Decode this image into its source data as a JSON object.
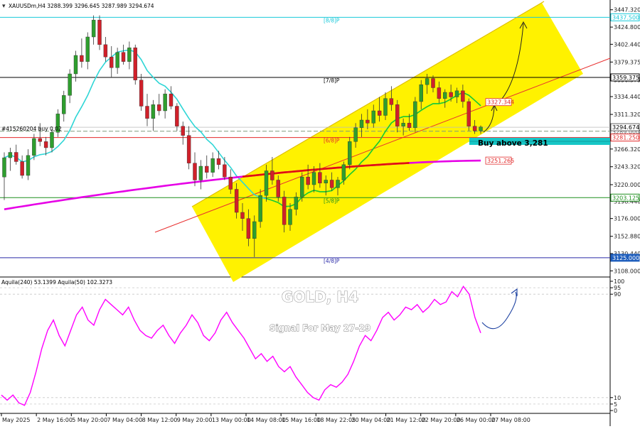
{
  "header": {
    "symbol_line": "XAUUSDm,H4  3288.399 3296.645 3287.989 3294.674",
    "order_label": "#415260204 buy 0.02"
  },
  "annotations": {
    "title": "GOLD, H4",
    "subtitle": "Signal For May 27-29",
    "buy_text": "Buy above 3,281"
  },
  "colors": {
    "channel_fill": "#fff200",
    "candle_up": "#2e9e2e",
    "candle_down": "#d0202a",
    "ma_sma21": "#2fd6d6",
    "ma_sma200": "#e600e6",
    "ma_green": "#22cc22",
    "ma_red": "#e01010",
    "oscillator": "#ff00ff",
    "price_tag": "#1f5ebd"
  },
  "chart_data": [
    {
      "type": "candlestick",
      "symbol": "XAUUSDm",
      "timeframe": "H4",
      "header_values": {
        "open": 3288.399,
        "high": 3296.645,
        "low": 3287.989,
        "close": 3294.674
      },
      "ylim": [
        3100,
        3460
      ],
      "y_ticks": [
        3447.32,
        3424.8,
        3402.44,
        3379.375,
        3356.375,
        3334.44,
        3311.32,
        3289.0,
        3266.32,
        3243.32,
        3220.0,
        3198.44,
        3176.0,
        3152.88,
        3130.44,
        3108.0
      ],
      "x_ticks": [
        "May 2025",
        "2 May 16:00",
        "5 May 20:00",
        "7 May 04:00",
        "8 May 12:00",
        "9 May 20:00",
        "13 May 00:00",
        "14 May 08:00",
        "15 May 16:00",
        "18 May 22:05",
        "20 May 04:00",
        "21 May 12:00",
        "22 May 20:00",
        "26 May 00:00",
        "27 May 08:00"
      ],
      "ohlc": [
        [
          3230,
          3262,
          3200,
          3255
        ],
        [
          3255,
          3268,
          3238,
          3262
        ],
        [
          3262,
          3272,
          3246,
          3250
        ],
        [
          3250,
          3258,
          3228,
          3232
        ],
        [
          3232,
          3266,
          3226,
          3258
        ],
        [
          3258,
          3286,
          3252,
          3280
        ],
        [
          3280,
          3300,
          3270,
          3276
        ],
        [
          3276,
          3282,
          3258,
          3268
        ],
        [
          3268,
          3292,
          3262,
          3288
        ],
        [
          3288,
          3318,
          3282,
          3312
        ],
        [
          3312,
          3342,
          3302,
          3336
        ],
        [
          3336,
          3370,
          3326,
          3364
        ],
        [
          3364,
          3394,
          3354,
          3388
        ],
        [
          3388,
          3410,
          3372,
          3380
        ],
        [
          3380,
          3418,
          3370,
          3412
        ],
        [
          3412,
          3440,
          3402,
          3434
        ],
        [
          3434,
          3440,
          3395,
          3402
        ],
        [
          3402,
          3412,
          3380,
          3386
        ],
        [
          3386,
          3400,
          3360,
          3372
        ],
        [
          3372,
          3398,
          3364,
          3392
        ],
        [
          3392,
          3402,
          3376,
          3380
        ],
        [
          3380,
          3406,
          3370,
          3398
        ],
        [
          3398,
          3402,
          3350,
          3356
        ],
        [
          3356,
          3364,
          3316,
          3322
        ],
        [
          3322,
          3338,
          3296,
          3306
        ],
        [
          3306,
          3330,
          3290,
          3324
        ],
        [
          3324,
          3338,
          3310,
          3316
        ],
        [
          3316,
          3344,
          3306,
          3338
        ],
        [
          3338,
          3348,
          3318,
          3322
        ],
        [
          3322,
          3326,
          3290,
          3296
        ],
        [
          3296,
          3302,
          3272,
          3284
        ],
        [
          3284,
          3296,
          3240,
          3248
        ],
        [
          3248,
          3262,
          3218,
          3226
        ],
        [
          3226,
          3252,
          3214,
          3244
        ],
        [
          3244,
          3258,
          3228,
          3236
        ],
        [
          3236,
          3262,
          3230,
          3254
        ],
        [
          3254,
          3264,
          3240,
          3246
        ],
        [
          3246,
          3256,
          3226,
          3230
        ],
        [
          3230,
          3240,
          3208,
          3214
        ],
        [
          3214,
          3222,
          3176,
          3184
        ],
        [
          3184,
          3196,
          3160,
          3176
        ],
        [
          3176,
          3188,
          3140,
          3150
        ],
        [
          3150,
          3180,
          3126,
          3172
        ],
        [
          3172,
          3214,
          3164,
          3206
        ],
        [
          3206,
          3246,
          3198,
          3238
        ],
        [
          3238,
          3256,
          3220,
          3226
        ],
        [
          3226,
          3232,
          3198,
          3204
        ],
        [
          3204,
          3212,
          3158,
          3168
        ],
        [
          3168,
          3196,
          3160,
          3188
        ],
        [
          3188,
          3210,
          3180,
          3204
        ],
        [
          3204,
          3236,
          3198,
          3230
        ],
        [
          3230,
          3246,
          3214,
          3220
        ],
        [
          3220,
          3244,
          3210,
          3236
        ],
        [
          3236,
          3248,
          3216,
          3222
        ],
        [
          3222,
          3232,
          3206,
          3226
        ],
        [
          3226,
          3236,
          3212,
          3216
        ],
        [
          3216,
          3230,
          3206,
          3226
        ],
        [
          3226,
          3250,
          3220,
          3246
        ],
        [
          3246,
          3282,
          3240,
          3276
        ],
        [
          3276,
          3300,
          3268,
          3294
        ],
        [
          3294,
          3312,
          3282,
          3304
        ],
        [
          3304,
          3318,
          3292,
          3300
        ],
        [
          3300,
          3324,
          3294,
          3316
        ],
        [
          3316,
          3334,
          3302,
          3310
        ],
        [
          3310,
          3340,
          3304,
          3332
        ],
        [
          3332,
          3348,
          3316,
          3324
        ],
        [
          3324,
          3330,
          3288,
          3296
        ],
        [
          3296,
          3306,
          3284,
          3300
        ],
        [
          3300,
          3312,
          3290,
          3294
        ],
        [
          3294,
          3334,
          3288,
          3328
        ],
        [
          3328,
          3356,
          3318,
          3350
        ],
        [
          3350,
          3364,
          3338,
          3358
        ],
        [
          3358,
          3362,
          3340,
          3346
        ],
        [
          3346,
          3354,
          3326,
          3332
        ],
        [
          3332,
          3344,
          3320,
          3340
        ],
        [
          3340,
          3350,
          3328,
          3334
        ],
        [
          3334,
          3346,
          3326,
          3342
        ],
        [
          3342,
          3350,
          3320,
          3328
        ],
        [
          3328,
          3332,
          3290,
          3296
        ],
        [
          3296,
          3304,
          3286,
          3290
        ],
        [
          3290,
          3297,
          3286,
          3295
        ]
      ]
    },
    {
      "type": "line",
      "name": "Aquila(240) 53.1399 Aquila(50) 102.3273",
      "ylim": [
        0,
        100
      ],
      "y_ticks": [
        100,
        95,
        90,
        10,
        5,
        0
      ],
      "values": [
        12,
        8,
        12,
        6,
        4,
        14,
        30,
        48,
        62,
        70,
        58,
        50,
        62,
        74,
        80,
        70,
        66,
        78,
        86,
        82,
        78,
        74,
        80,
        70,
        62,
        58,
        56,
        62,
        66,
        58,
        52,
        60,
        66,
        74,
        68,
        58,
        54,
        60,
        70,
        76,
        68,
        62,
        56,
        48,
        40,
        44,
        38,
        42,
        34,
        30,
        34,
        26,
        20,
        14,
        10,
        8,
        16,
        20,
        18,
        22,
        28,
        38,
        50,
        58,
        54,
        62,
        72,
        76,
        70,
        74,
        80,
        78,
        82,
        76,
        80,
        86,
        82,
        84,
        92,
        88,
        96,
        90,
        72,
        60
      ]
    }
  ],
  "levels": [
    {
      "label": "[8/8]P",
      "price_tag": "3437.500"
    },
    {
      "label": "[7/8]P",
      "price_tag": "3359.375"
    },
    {
      "label": "[6/8]P",
      "price_tag": "3281.250"
    },
    {
      "label": "[5/8]P",
      "price_tag": "3203.125"
    },
    {
      "label": "[4/8]P",
      "price_tag": "3125.000"
    }
  ],
  "tags": {
    "current": "3294.674",
    "current_underlay": "3289.000",
    "target": "3327.344",
    "sma200": "3251.265"
  },
  "osc_ticks": [
    "100",
    "95",
    "90",
    "10",
    "5",
    "0"
  ]
}
